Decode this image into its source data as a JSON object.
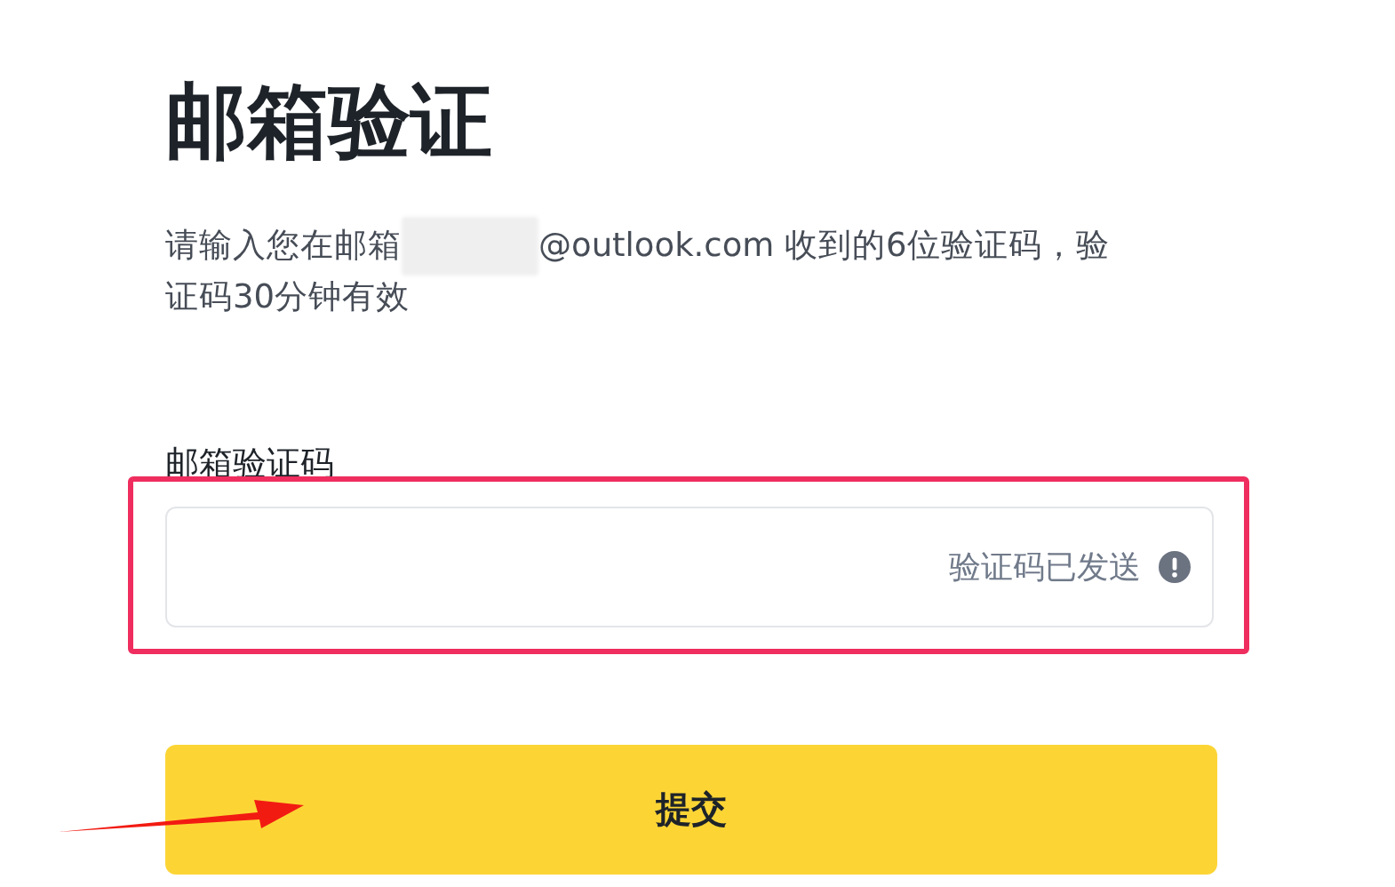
{
  "title": "邮箱验证",
  "description": {
    "before": "请输入您在邮箱",
    "after_lines": [
      "@outlook.com 收到的6位验证码，验",
      "证码30分钟有效"
    ]
  },
  "code_field": {
    "label": "邮箱验证码",
    "status": "验证码已发送"
  },
  "submit_button": "提交"
}
